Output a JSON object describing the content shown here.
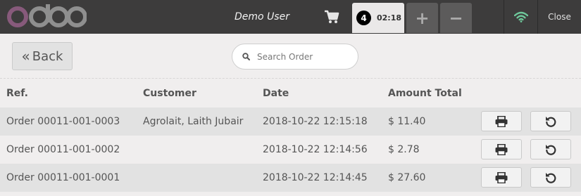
{
  "header": {
    "logo_text": "odoo",
    "user_name": "Demo User",
    "order_tab": {
      "count": "4",
      "time": "02:18"
    },
    "add_tab": "+",
    "remove_tab": "−",
    "close_label": "Close"
  },
  "toolbar": {
    "back_label": "Back",
    "search_placeholder": "Search Order"
  },
  "table": {
    "columns": [
      "Ref.",
      "Customer",
      "Date",
      "Amount Total"
    ],
    "rows": [
      {
        "ref": "Order 00011-001-0003",
        "customer": "Agrolait, Laith Jubair",
        "date": "2018-10-22 12:15:18",
        "amount": "$ 11.40"
      },
      {
        "ref": "Order 00011-001-0002",
        "customer": "",
        "date": "2018-10-22 12:14:56",
        "amount": "$ 2.78"
      },
      {
        "ref": "Order 00011-001-0001",
        "customer": "",
        "date": "2018-10-22 12:14:45",
        "amount": "$ 27.60"
      }
    ]
  },
  "icons": {
    "cart": "shopping-cart-icon",
    "wifi": "wifi-icon",
    "search": "search-icon",
    "print": "print-icon",
    "reprint": "undo-icon"
  },
  "colors": {
    "topbar": "#3d3c3c",
    "logo_purple": "#875a7b",
    "logo_gray": "#8f8f8f",
    "wifi_green": "#6ec89b",
    "row_alt": "#e2e2e2",
    "background": "#f0eeee"
  }
}
